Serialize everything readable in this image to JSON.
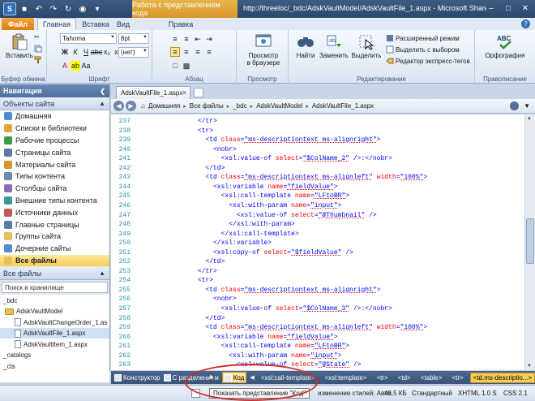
{
  "window": {
    "context_tab_title": "Работа с представлением кода",
    "title": "http://threeloc/_bdc/AdskVaultModel/AdskVaultFile_1.aspx - Microsoft SharePoint Designer",
    "qat_logo": "S"
  },
  "ribbon_tabs": {
    "file": "Файл",
    "home": "Главная",
    "insert": "Вставка",
    "view": "Вид",
    "edit": "Правка"
  },
  "ribbon": {
    "clipboard": {
      "label": "Буфер обмена",
      "paste": "Вставить"
    },
    "font": {
      "label": "Шрифт",
      "family": "Tahoma",
      "size": "8pt",
      "style": "(нет)"
    },
    "paragraph": {
      "label": "Абзац"
    },
    "preview": {
      "label": "Просмотр",
      "btn_line1": "Просмотр",
      "btn_line2": "в браузере"
    },
    "editing": {
      "label": "Редактирование",
      "find": "Найти",
      "replace": "Заменить",
      "select": "Выделить",
      "advanced_mode": "Расширенный режим",
      "select_with_choice": "Выделить с выбором",
      "quick_tag_editor": "Редактор экспресс-тегов"
    },
    "proofing": {
      "label": "Правописание",
      "spelling": "Орфография",
      "abc": "ABC"
    }
  },
  "nav": {
    "title": "Навигация",
    "site_objects": "Объекты сайта",
    "items": [
      "Домашняя",
      "Списки и библиотеки",
      "Рабочие процессы",
      "Страницы сайта",
      "Материалы сайта",
      "Типы контента",
      "Столбцы сайта",
      "Внешние типы контента",
      "Источники данных",
      "Главные страницы",
      "Группы сайта",
      "Дочерние сайты",
      "Все файлы"
    ],
    "all_files": "Все файлы",
    "search": "Поиск в хранилище",
    "tree": [
      "_bdc",
      "AdskVaultModel",
      "AdskVaultChangeOrder_1.as",
      "AdskVaultFile_1.aspx",
      "AdskVaultItem_1.aspx",
      "_catalogs",
      "_cts"
    ]
  },
  "document": {
    "tab": "AdskVaultFile_1.aspx",
    "breadcrumb": [
      "Домашняя",
      "Все файлы",
      "_bdc",
      "AdskVaultModel",
      "AdskVaultFile_1.aspx"
    ]
  },
  "code": {
    "line_numbers": [
      "237",
      "238",
      "239",
      "240",
      "241",
      "242",
      "243",
      "244",
      "245",
      "246",
      "247",
      "248",
      "249",
      "250",
      "251",
      "252",
      "253",
      "254",
      "255",
      "256",
      "257",
      "258",
      "259",
      "260",
      "261",
      "262",
      "263"
    ]
  },
  "viewbar": {
    "design": "Конструктор",
    "split": "С разделением",
    "code": "Код",
    "tags": [
      "<xsl:call-template>",
      "<xsl:template>",
      "<tr>",
      "<td>",
      "<table>",
      "<tr>",
      "<td.ms-descriptio...>"
    ]
  },
  "status": {
    "style_changes": "изменение стилей: Авто",
    "size": "48,5 КБ",
    "mode": "Стандартный",
    "doctype": "XHTML 1.0 S",
    "css": "CSS 2.1",
    "tooltip": "Показать представление \"Код\""
  },
  "colors": {
    "accent_blue": "#2d476b",
    "context_orange": "#d9962a",
    "selection_yellow": "#f7cf56",
    "annotation_red": "#d32b2b"
  }
}
